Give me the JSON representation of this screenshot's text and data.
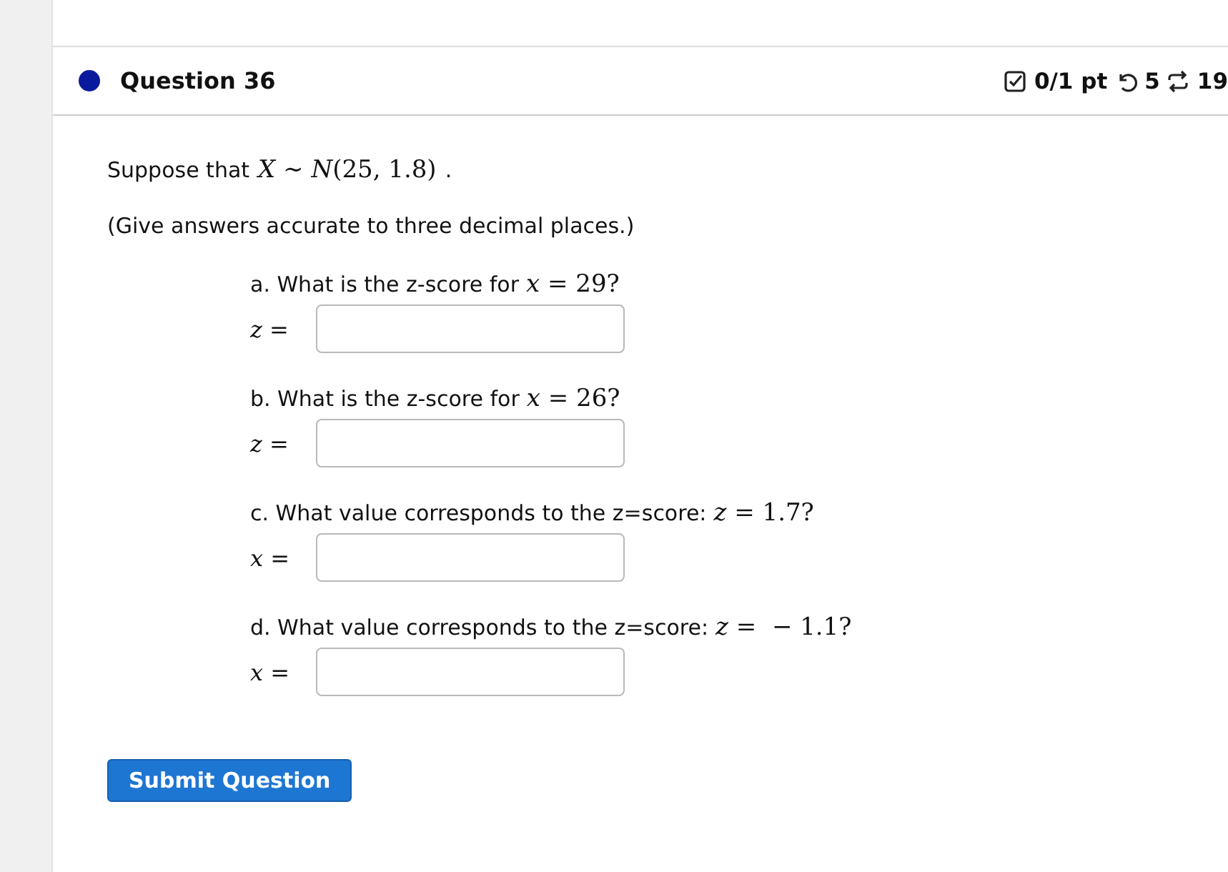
{
  "question": {
    "title": "Question 36",
    "score": "0/1 pt",
    "retries": "5",
    "attempts": "19"
  },
  "intro": {
    "text": "Suppose that",
    "math": "*X* ∼ *N*(25, 1.8)",
    "tail": "."
  },
  "instructions": "(Give answers accurate to three decimal places.)",
  "parts": [
    {
      "text": "a. What is the z-score for",
      "math": "*x* = 29?",
      "variable": "*z* ="
    },
    {
      "text": "b. What is the z-score for",
      "math": "*x* = 26?",
      "variable": "*z* ="
    },
    {
      "text": "c. What value corresponds to the z=score:",
      "math": "*z* = 1.7?",
      "variable": "*x* ="
    },
    {
      "text": "d. What value corresponds to the z=score:",
      "math": "*z* =  − 1.1?",
      "variable": "*x* ="
    }
  ],
  "submit": "Submit Question"
}
